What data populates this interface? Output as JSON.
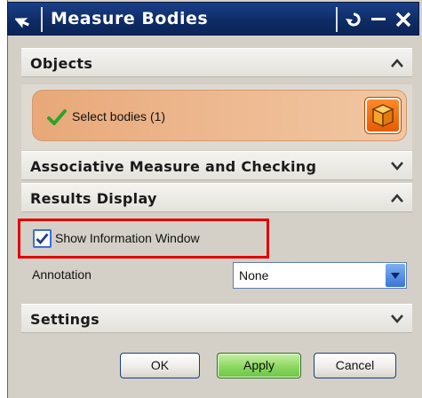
{
  "dialog": {
    "title": "Measure Bodies"
  },
  "sections": {
    "objects": {
      "title": "Objects",
      "select_label": "Select bodies (1)"
    },
    "associative": {
      "title": "Associative Measure and Checking"
    },
    "results": {
      "title": "Results Display",
      "show_info_label": "Show Information Window",
      "show_info_checked": true,
      "annotation_label": "Annotation",
      "annotation_value": "None"
    },
    "settings": {
      "title": "Settings"
    }
  },
  "buttons": {
    "ok": "OK",
    "apply": "Apply",
    "cancel": "Cancel"
  },
  "icons": {
    "title": "select-arrow-icon",
    "reset": "reset-icon",
    "minimize": "minimize-icon",
    "close": "close-icon",
    "check": "checkmark-icon",
    "cube": "cube-icon",
    "dropdown": "dropdown-arrow-icon"
  },
  "colors": {
    "title_bar": "#0f2c66",
    "selection_row": "#edb78e",
    "cube_button": "#ff7a1a",
    "highlight": "#e00000",
    "apply_button": "#8cd860"
  }
}
